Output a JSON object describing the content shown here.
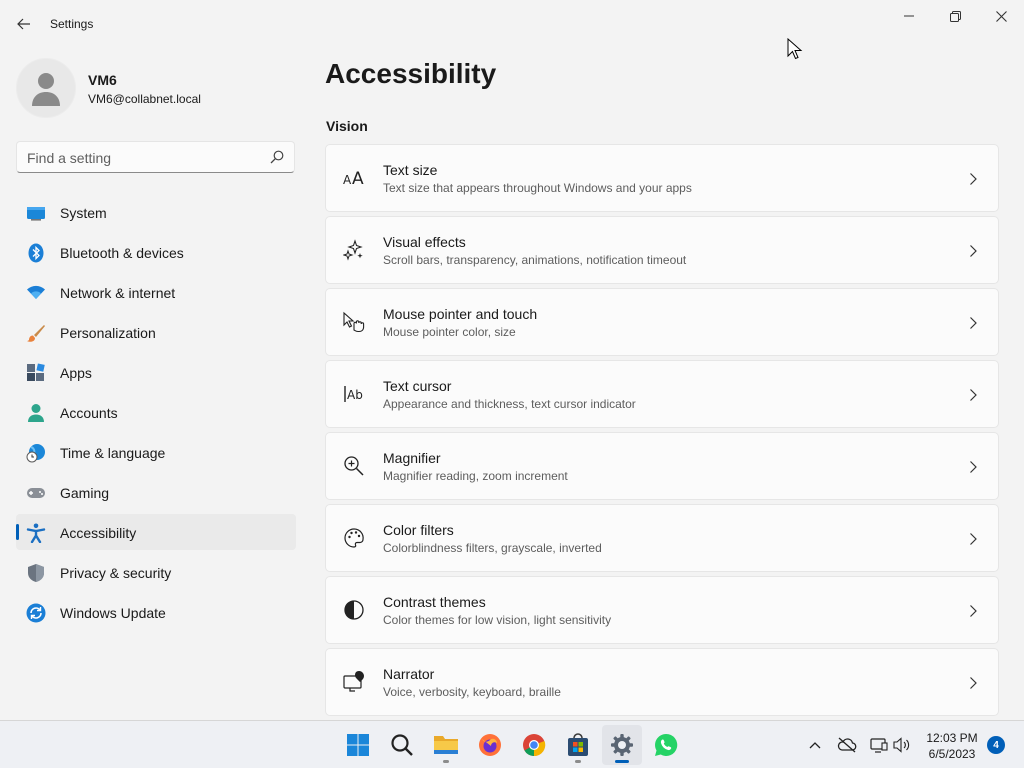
{
  "window": {
    "title": "Settings",
    "controls": [
      "minimize",
      "maximize",
      "close"
    ]
  },
  "profile": {
    "name": "VM6",
    "email": "VM6@collabnet.local"
  },
  "search": {
    "placeholder": "Find a setting"
  },
  "nav": {
    "items": [
      {
        "label": "System",
        "icon": "system-icon"
      },
      {
        "label": "Bluetooth & devices",
        "icon": "bluetooth-icon"
      },
      {
        "label": "Network & internet",
        "icon": "wifi-icon"
      },
      {
        "label": "Personalization",
        "icon": "brush-icon"
      },
      {
        "label": "Apps",
        "icon": "apps-icon"
      },
      {
        "label": "Accounts",
        "icon": "accounts-icon"
      },
      {
        "label": "Time & language",
        "icon": "globe-clock-icon"
      },
      {
        "label": "Gaming",
        "icon": "gamepad-icon"
      },
      {
        "label": "Accessibility",
        "icon": "accessibility-icon",
        "active": true
      },
      {
        "label": "Privacy & security",
        "icon": "shield-icon"
      },
      {
        "label": "Windows Update",
        "icon": "update-icon"
      }
    ]
  },
  "main": {
    "title": "Accessibility",
    "section": "Vision",
    "cards": [
      {
        "title": "Text size",
        "desc": "Text size that appears throughout Windows and your apps",
        "icon": "text-size-icon"
      },
      {
        "title": "Visual effects",
        "desc": "Scroll bars, transparency, animations, notification timeout",
        "icon": "sparkle-icon"
      },
      {
        "title": "Mouse pointer and touch",
        "desc": "Mouse pointer color, size",
        "icon": "pointer-touch-icon"
      },
      {
        "title": "Text cursor",
        "desc": "Appearance and thickness, text cursor indicator",
        "icon": "text-cursor-icon"
      },
      {
        "title": "Magnifier",
        "desc": "Magnifier reading, zoom increment",
        "icon": "magnifier-icon"
      },
      {
        "title": "Color filters",
        "desc": "Colorblindness filters, grayscale, inverted",
        "icon": "palette-icon"
      },
      {
        "title": "Contrast themes",
        "desc": "Color themes for low vision, light sensitivity",
        "icon": "contrast-icon"
      },
      {
        "title": "Narrator",
        "desc": "Voice, verbosity, keyboard, braille",
        "icon": "narrator-icon"
      }
    ]
  },
  "taskbar": {
    "apps": [
      "start-icon",
      "search-icon",
      "file-explorer-icon",
      "firefox-icon",
      "chrome-icon",
      "store-icon",
      "settings-icon",
      "whatsapp-icon"
    ],
    "time": "12:03 PM",
    "date": "6/5/2023",
    "notifications": "4"
  },
  "colors": {
    "accent": "#005fb8",
    "background": "#f3f3f3",
    "card": "#fbfbfb"
  }
}
